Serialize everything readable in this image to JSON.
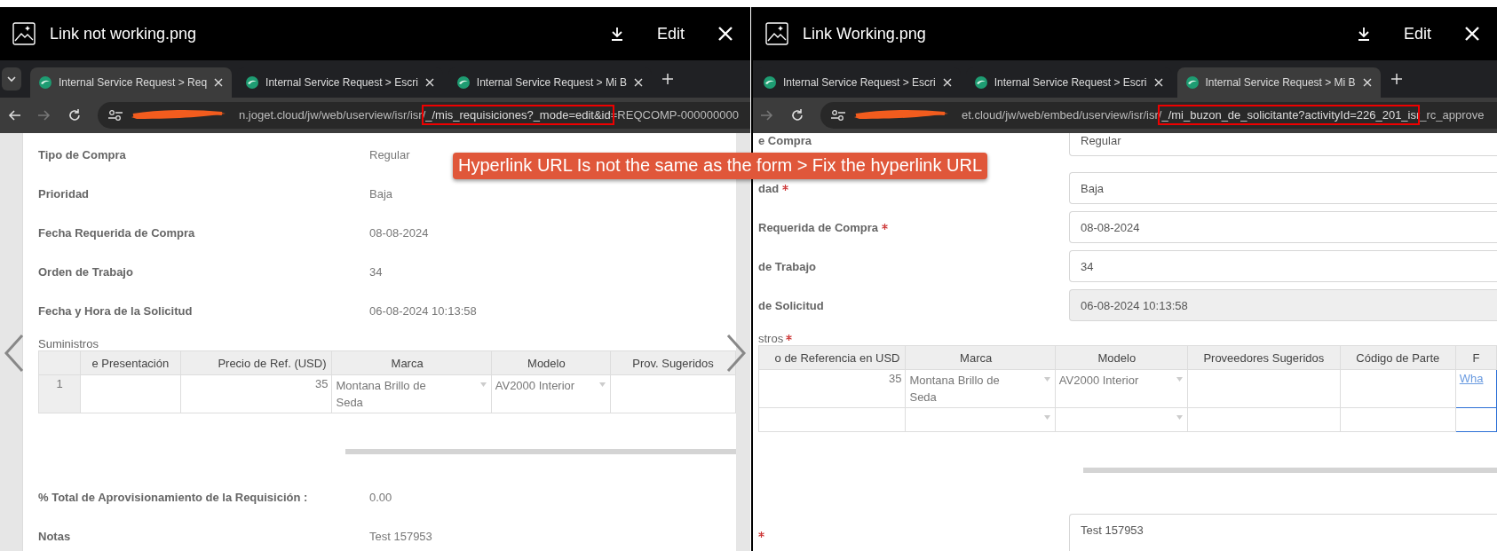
{
  "viewers": [
    {
      "title": "Link not working.png",
      "edit_label": "Edit",
      "tab_menu": true,
      "pager": true,
      "tabs": [
        {
          "title": "Internal Service Request >  Req",
          "selected": true
        },
        {
          "title": "Internal Service Request > Escri",
          "selected": false
        },
        {
          "title": "Internal Service Request > Mi B",
          "selected": false
        }
      ],
      "nav_buttons": [
        {
          "kind": "back",
          "disabled": false
        },
        {
          "kind": "forward",
          "disabled": true
        },
        {
          "kind": "reload",
          "disabled": false
        }
      ],
      "url": [
        {
          "text": "n.joget.cloud/jw/web/userview/isr/isr/",
          "highlighted": false
        },
        {
          "text": "_/mis_requisiciones?_mode=edit&id",
          "highlighted": true
        },
        {
          "text": "=REQCOMP-000000000",
          "highlighted": false
        }
      ],
      "page": {
        "kind": "view",
        "fields": [
          {
            "label": "Tipo de Compra",
            "value": "Regular"
          },
          {
            "label": "Prioridad",
            "value": "Baja"
          },
          {
            "label": "Fecha Requerida de Compra",
            "value": "08-08-2024"
          },
          {
            "label": "Orden de Trabajo",
            "value": "34"
          },
          {
            "label": "Fecha y Hora de la Solicitud",
            "value": "06-08-2024 10:13:58"
          }
        ],
        "grid": {
          "label": "Suministros",
          "columns": [
            {
              "kind": "index"
            },
            {
              "label": "e Presentación",
              "kind": "text"
            },
            {
              "label": "Precio de Ref. (USD)",
              "kind": "number"
            },
            {
              "label": "Marca",
              "kind": "select"
            },
            {
              "label": "Modelo",
              "kind": "select"
            },
            {
              "label": "Prov. Sugeridos",
              "kind": "text"
            }
          ],
          "rows": [
            [
              "1",
              null,
              "35",
              "Montana Brillo de Seda",
              "AV2000 Interior",
              null
            ]
          ]
        },
        "after_fields": [
          {
            "label": "% Total de Aprovisionamiento de la Requisición :",
            "value": "0.00"
          },
          {
            "label": "Notas",
            "value": "Test 157953"
          }
        ]
      }
    },
    {
      "title": "Link Working.png",
      "edit_label": "Edit",
      "tabs": [
        {
          "title": "Internal Service Request > Escri",
          "selected": false
        },
        {
          "title": "Internal Service Request > Escri",
          "selected": false
        },
        {
          "title": "Internal Service Request > Mi B",
          "selected": true
        }
      ],
      "nav_buttons": [
        {
          "kind": "forward",
          "disabled": true
        },
        {
          "kind": "reload",
          "disabled": false
        }
      ],
      "url": [
        {
          "text": "et.cloud/jw/web/embed/userview/isr/isr/",
          "highlighted": false
        },
        {
          "text": "_/mi_buzon_de_solicitante?activityId=226_201_is",
          "highlighted": true
        },
        {
          "text": "r_rc_approve",
          "highlighted": false
        }
      ],
      "page": {
        "kind": "form",
        "fields": [
          {
            "label": "e Compra",
            "value": "Regular",
            "disabled": false
          },
          {
            "label": "dad",
            "value": "Baja",
            "required": true,
            "disabled": false
          },
          {
            "label": "Requerida de Compra",
            "value": "08-08-2024",
            "required": true,
            "disabled": false
          },
          {
            "label": "de Trabajo",
            "value": "34",
            "disabled": false
          },
          {
            "label": "de Solicitud",
            "value": "06-08-2024 10:13:58",
            "disabled": true
          }
        ],
        "grid": {
          "label": "stros",
          "required": true,
          "columns": [
            {
              "label": "o de Referencia en USD",
              "kind": "number"
            },
            {
              "label": "Marca",
              "kind": "select"
            },
            {
              "label": "Modelo",
              "kind": "select"
            },
            {
              "label": "Proveedores Sugeridos",
              "kind": "text"
            },
            {
              "label": "Código de Parte",
              "kind": "text"
            },
            {
              "label": "F",
              "kind": "link"
            }
          ],
          "rows": [
            [
              "35",
              "Montana Brillo de Seda",
              "AV2000 Interior",
              null,
              null,
              "Wha"
            ],
            [
              null,
              null,
              null,
              null,
              null,
              null
            ]
          ]
        },
        "after_fields": [
          {
            "value": "Test 157953",
            "required": true,
            "disabled": false,
            "multiline": true
          }
        ]
      }
    }
  ],
  "callout": {
    "text": "Hyperlink URL Is not the same as the form > Fix the hyperlink URL"
  }
}
